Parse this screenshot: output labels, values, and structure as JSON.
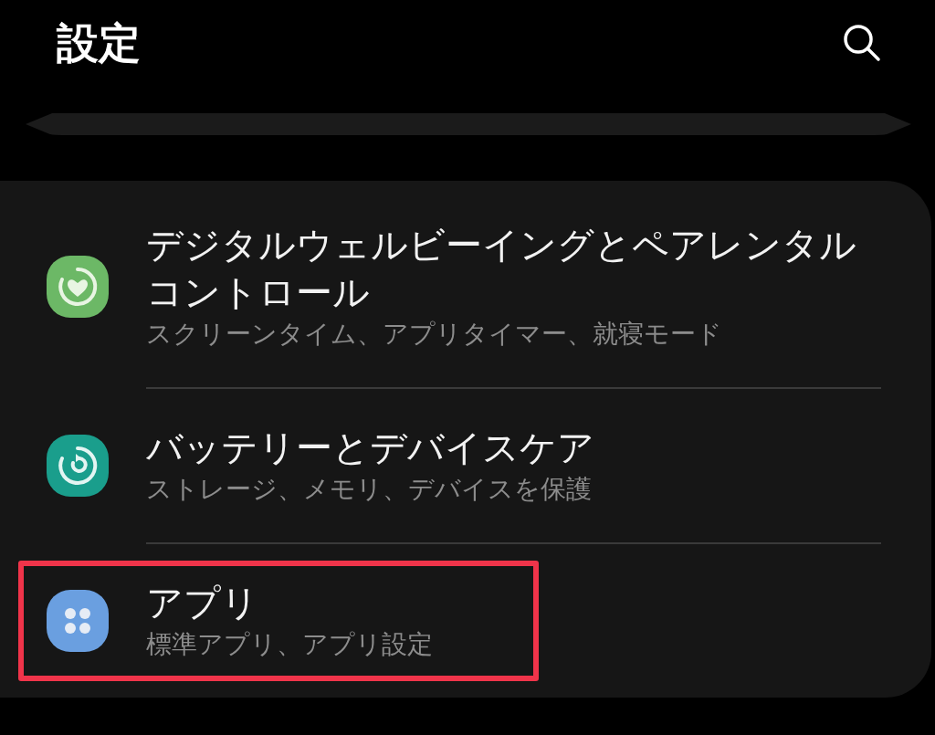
{
  "header": {
    "title": "設定"
  },
  "items": [
    {
      "title": "デジタルウェルビーイングとペアレンタルコントロール",
      "subtitle": "スクリーンタイム、アプリタイマー、就寝モード",
      "kind": "wellbeing",
      "color": "#6cb866",
      "highlighted": false
    },
    {
      "title": "バッテリーとデバイスケア",
      "subtitle": "ストレージ、メモリ、デバイスを保護",
      "kind": "care",
      "color": "#1a9e8c",
      "highlighted": false
    },
    {
      "title": "アプリ",
      "subtitle": "標準アプリ、アプリ設定",
      "kind": "apps",
      "color": "#6a9fe0",
      "highlighted": true
    }
  ]
}
